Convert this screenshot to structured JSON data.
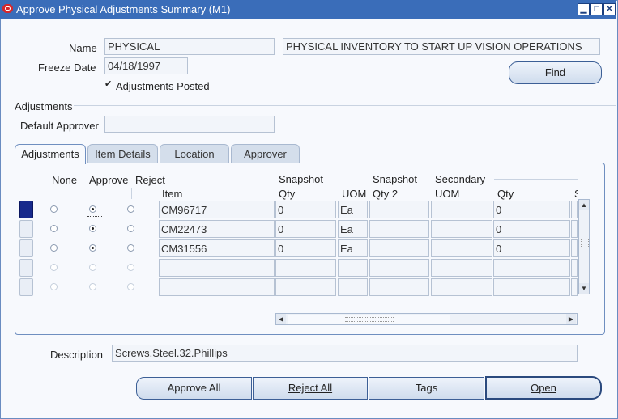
{
  "window": {
    "title": "Approve Physical Adjustments Summary (M1)"
  },
  "header": {
    "name_label": "Name",
    "name_value": "PHYSICAL",
    "name_description": "PHYSICAL INVENTORY TO START UP VISION OPERATIONS",
    "freeze_date_label": "Freeze Date",
    "freeze_date_value": "04/18/1997",
    "adjustments_posted_label": "Adjustments Posted",
    "adjustments_posted_checked": true,
    "find_label": "Find"
  },
  "adjustments_section": {
    "title": "Adjustments",
    "default_approver_label": "Default Approver",
    "default_approver_value": ""
  },
  "tabs": [
    {
      "label": "Adjustments",
      "active": true
    },
    {
      "label": "Item Details",
      "active": false
    },
    {
      "label": "Location",
      "active": false
    },
    {
      "label": "Approver",
      "active": false
    }
  ],
  "table": {
    "headers": {
      "none": "None",
      "approve": "Approve",
      "reject": "Reject",
      "item": "Item",
      "snapshot_qty_1": "Snapshot",
      "snapshot_qty_2": "Qty",
      "uom": "UOM",
      "snapshot_qty2_1": "Snapshot",
      "snapshot_qty2_2": "Qty 2",
      "secondary": "Secondary",
      "secondary_uom": "UOM",
      "secondary_qty": "Qty",
      "cut_off": "S"
    },
    "rows": [
      {
        "item": "CM96717",
        "snapshot_qty": "0",
        "uom": "Ea",
        "snapshot_qty2": "",
        "secondary_uom": "",
        "secondary_qty": "0",
        "selected": "approve",
        "current": true
      },
      {
        "item": "CM22473",
        "snapshot_qty": "0",
        "uom": "Ea",
        "snapshot_qty2": "",
        "secondary_uom": "",
        "secondary_qty": "0",
        "selected": "approve",
        "current": false
      },
      {
        "item": "CM31556",
        "snapshot_qty": "0",
        "uom": "Ea",
        "snapshot_qty2": "",
        "secondary_uom": "",
        "secondary_qty": "0",
        "selected": "approve",
        "current": false
      },
      {
        "item": "",
        "snapshot_qty": "",
        "uom": "",
        "snapshot_qty2": "",
        "secondary_uom": "",
        "secondary_qty": "",
        "selected": "none",
        "current": false
      },
      {
        "item": "",
        "snapshot_qty": "",
        "uom": "",
        "snapshot_qty2": "",
        "secondary_uom": "",
        "secondary_qty": "",
        "selected": "none",
        "current": false
      }
    ]
  },
  "footer": {
    "description_label": "Description",
    "description_value": "Screws.Steel.32.Phillips",
    "buttons": {
      "approve_all": "Approve All",
      "reject_all": "Reject All",
      "tags": "Tags",
      "open": "Open"
    }
  },
  "colors": {
    "titlebar": "#3a6db9",
    "current_row": "#17298c",
    "panel_border": "#6f8fc0"
  }
}
